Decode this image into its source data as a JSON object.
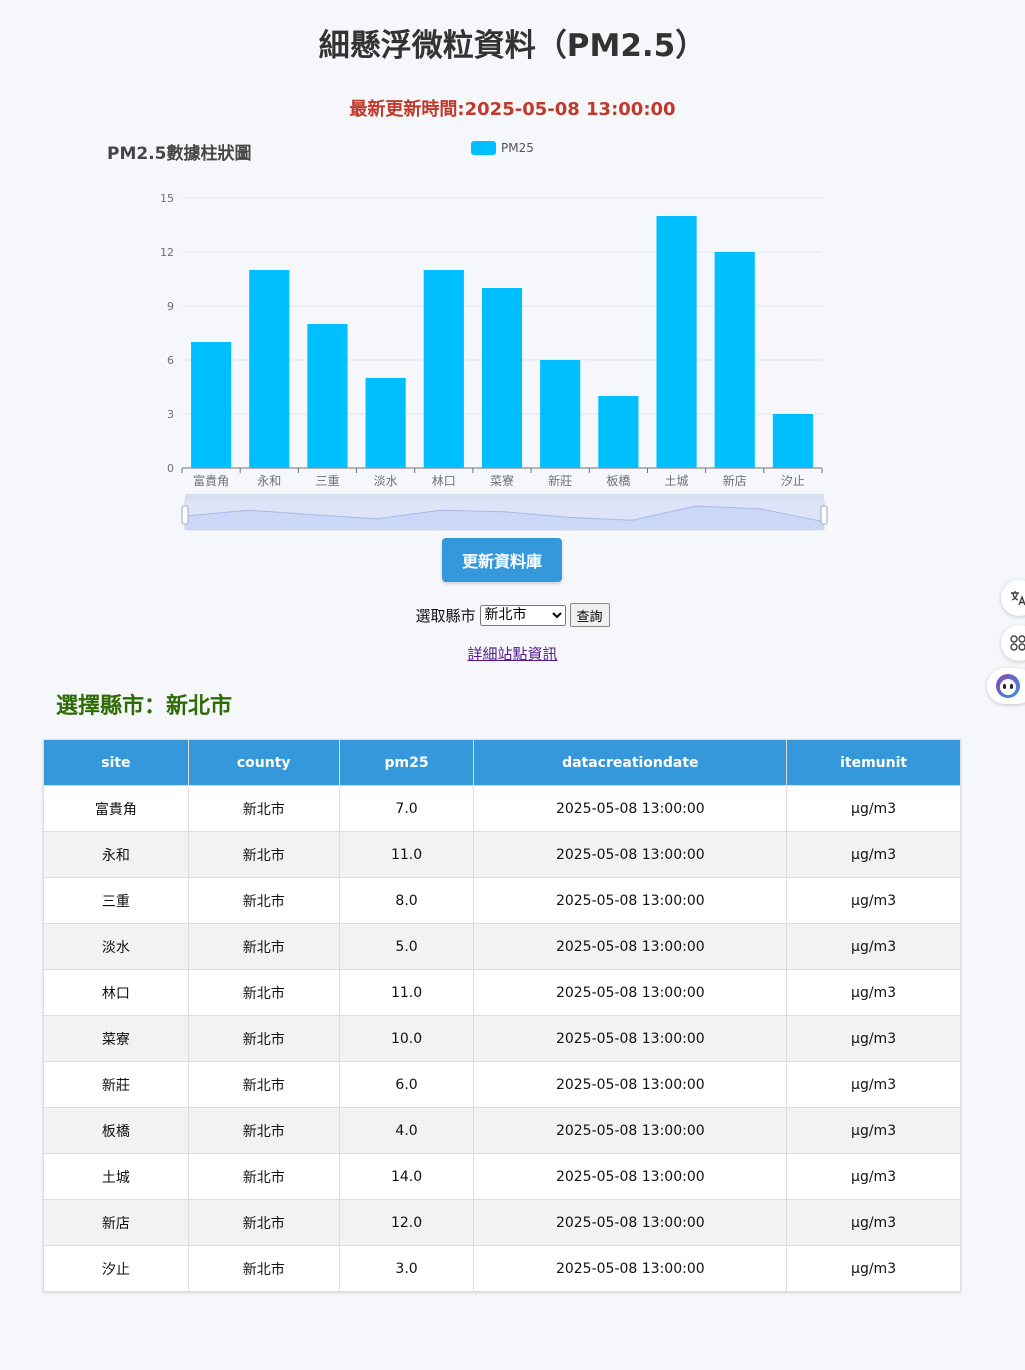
{
  "page": {
    "title": "細懸浮微粒資料（PM2.5）",
    "update_time": "最新更新時間:2025-05-08 13:00:00"
  },
  "chart_data": {
    "type": "bar",
    "title": "PM2.5數據柱狀圖",
    "categories": [
      "富貴角",
      "永和",
      "三重",
      "淡水",
      "林口",
      "菜寮",
      "新莊",
      "板橋",
      "土城",
      "新店",
      "汐止"
    ],
    "series": [
      {
        "name": "PM25",
        "values": [
          7,
          11,
          8,
          5,
          11,
          10,
          6,
          4,
          14,
          12,
          3
        ]
      }
    ],
    "ylim": [
      0,
      15
    ],
    "yticks": [
      0,
      3,
      6,
      9,
      12,
      15
    ],
    "grid": true,
    "legend_position": "top-center",
    "bar_color": "#00bfff",
    "has_data_zoom": true
  },
  "controls": {
    "update_button": "更新資料庫",
    "select_label": "選取縣市",
    "selected_county": "新北市",
    "query_button": "查詢",
    "detail_link": "詳細站點資訊"
  },
  "county_heading": "選擇縣市：新北市",
  "table": {
    "headers": [
      "site",
      "county",
      "pm25",
      "datacreationdate",
      "itemunit"
    ],
    "rows": [
      [
        "富貴角",
        "新北市",
        "7.0",
        "2025-05-08 13:00:00",
        "μg/m3"
      ],
      [
        "永和",
        "新北市",
        "11.0",
        "2025-05-08 13:00:00",
        "μg/m3"
      ],
      [
        "三重",
        "新北市",
        "8.0",
        "2025-05-08 13:00:00",
        "μg/m3"
      ],
      [
        "淡水",
        "新北市",
        "5.0",
        "2025-05-08 13:00:00",
        "μg/m3"
      ],
      [
        "林口",
        "新北市",
        "11.0",
        "2025-05-08 13:00:00",
        "μg/m3"
      ],
      [
        "菜寮",
        "新北市",
        "10.0",
        "2025-05-08 13:00:00",
        "μg/m3"
      ],
      [
        "新莊",
        "新北市",
        "6.0",
        "2025-05-08 13:00:00",
        "μg/m3"
      ],
      [
        "板橋",
        "新北市",
        "4.0",
        "2025-05-08 13:00:00",
        "μg/m3"
      ],
      [
        "土城",
        "新北市",
        "14.0",
        "2025-05-08 13:00:00",
        "μg/m3"
      ],
      [
        "新店",
        "新北市",
        "12.0",
        "2025-05-08 13:00:00",
        "μg/m3"
      ],
      [
        "汐止",
        "新北市",
        "3.0",
        "2025-05-08 13:00:00",
        "μg/m3"
      ]
    ]
  },
  "side_toolbar": {
    "translate_icon": "translate-icon",
    "apps_icon": "apps-icon",
    "assistant_icon": "robot-icon"
  },
  "colors": {
    "accent": "#3498db",
    "bar": "#00bfff",
    "update_time": "#c0392b",
    "county_heading": "#2e6b05"
  }
}
